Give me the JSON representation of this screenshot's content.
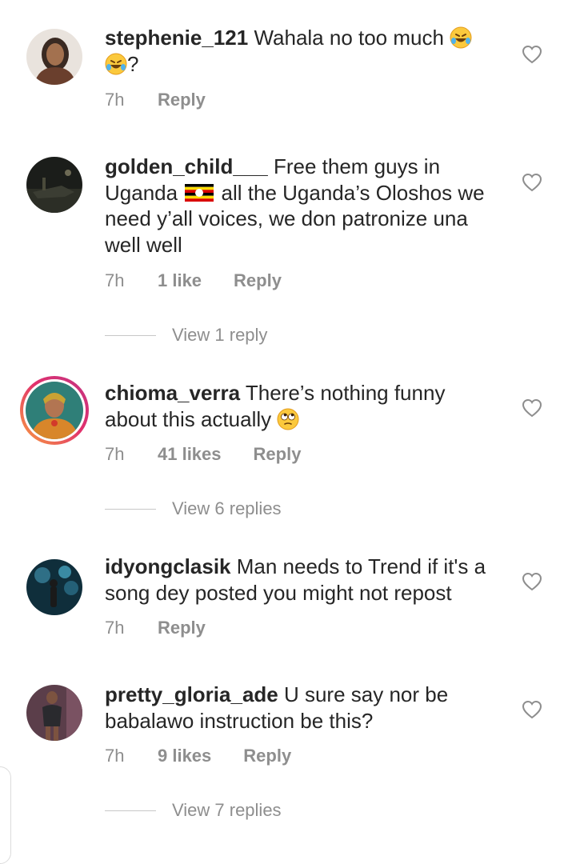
{
  "comments": [
    {
      "username": "stephenie_121",
      "text_a": " Wahala no too much ",
      "text_b": "?",
      "time": "7h",
      "reply": "Reply"
    },
    {
      "username": "golden_child___",
      "text_a": " Free them guys in Uganda ",
      "text_b": " all the Uganda’s Oloshos we need y’all voices, we don patronize una well well",
      "time": "7h",
      "likes": "1 like",
      "reply": "Reply",
      "view_replies": "View 1 reply"
    },
    {
      "username": "chioma_verra",
      "text_a": " There’s nothing funny about this actually ",
      "time": "7h",
      "likes": "41 likes",
      "reply": "Reply",
      "view_replies": "View 6 replies"
    },
    {
      "username": "idyongclasik",
      "text_a": " Man needs to Trend if it's a song dey posted you might not repost",
      "time": "7h",
      "reply": "Reply"
    },
    {
      "username": "pretty_gloria_ade",
      "text_a": " U sure say nor be babalawo instruction be this?",
      "time": "7h",
      "likes": "9 likes",
      "reply": "Reply",
      "view_replies": "View 7 replies"
    }
  ],
  "icons": {
    "like": "heart-outline-icon",
    "laughing": "rolling-on-floor-laughing-emoji",
    "eyeroll": "face-with-rolling-eyes-emoji",
    "flag": "uganda-flag-emoji"
  },
  "colors": {
    "text": "#262626",
    "secondary": "#8e8e8e",
    "story_ring_start": "#f9a03f",
    "story_ring_end": "#c13584"
  }
}
